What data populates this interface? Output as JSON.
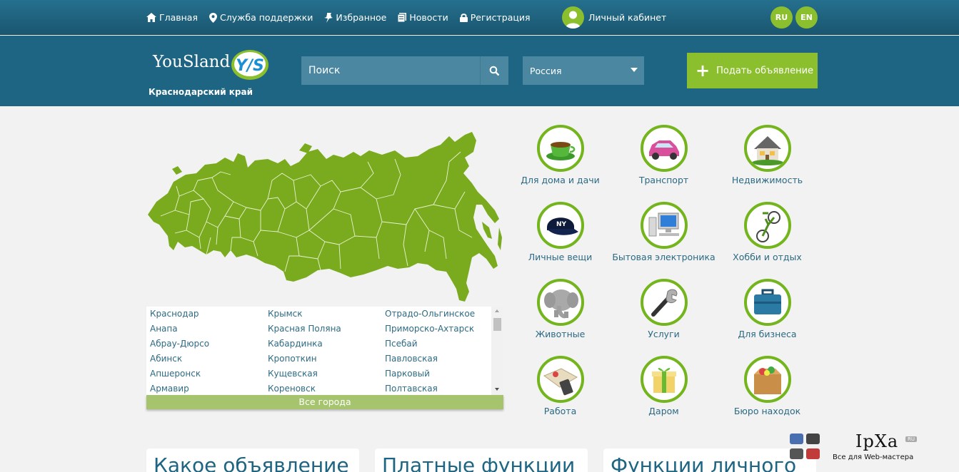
{
  "topnav": {
    "home": "Главная",
    "support": "Служба поддержки",
    "favorites": "Избранное",
    "news": "Новости",
    "register": "Регистрация",
    "cabinet": "Личный кабинет",
    "lang_ru": "RU",
    "lang_en": "EN"
  },
  "header": {
    "logo_text": "YouSland",
    "logo_badge": "Y/S",
    "region": "Краснодарский край",
    "search_placeholder": "Поиск",
    "country": "Россия",
    "post_ad": "Подать объявление"
  },
  "cities": {
    "col1": [
      "Краснодар",
      "Анапа",
      "Абрау-Дюрсо",
      "Абинск",
      "Апшеронск",
      "Армавир"
    ],
    "col2": [
      "Крымск",
      "Красная Поляна",
      "Кабардинка",
      "Кропоткин",
      "Кущевская",
      "Кореновск"
    ],
    "col3": [
      "Отрадо-Ольгинское",
      "Приморско-Ахтарск",
      "Псебай",
      "Павловская",
      "Парковый",
      "Полтавская"
    ],
    "all": "Все города"
  },
  "categories": [
    {
      "label": "Для дома и дачи",
      "icon": "teacup-icon"
    },
    {
      "label": "Транспорт",
      "icon": "car-icon"
    },
    {
      "label": "Недвижимость",
      "icon": "house-icon"
    },
    {
      "label": "Личные вещи",
      "icon": "cap-icon"
    },
    {
      "label": "Бытовая электроника",
      "icon": "computer-icon"
    },
    {
      "label": "Хобби и отдых",
      "icon": "bicycle-icon"
    },
    {
      "label": "Животные",
      "icon": "elephant-icon"
    },
    {
      "label": "Услуги",
      "icon": "wrench-icon"
    },
    {
      "label": "Для бизнеса",
      "icon": "briefcase-icon"
    },
    {
      "label": "Работа",
      "icon": "map-phone-icon"
    },
    {
      "label": "Даром",
      "icon": "gift-icon"
    },
    {
      "label": "Бюро находок",
      "icon": "box-icon"
    }
  ],
  "cards": [
    "Какое объявление",
    "Платные функции",
    "Функции личного"
  ],
  "watermark": {
    "logo": "IpXa",
    "badge": "RU",
    "sub": "Все для Web-мастера"
  },
  "colors": {
    "primary": "#1d6583",
    "accent": "#8cbf2d",
    "map": "#7aab1e",
    "background": "#f2f2f2"
  }
}
